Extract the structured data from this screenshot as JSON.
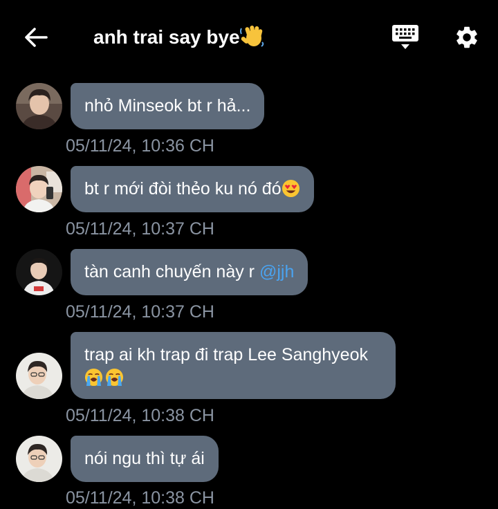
{
  "header": {
    "title": "anh trai say bye",
    "title_emoji": "waving-hand",
    "back_icon": "back-arrow-icon",
    "keyboard_icon": "keyboard-icon",
    "settings_icon": "gear-icon"
  },
  "messages": [
    {
      "text": "nhỏ Minseok bt r hả...",
      "time": "05/11/24, 10:36 CH"
    },
    {
      "text": "bt r mới đòi thẻo ku nó đó",
      "emoji": "heart-eyes-emoji",
      "time": "05/11/24, 10:37 CH"
    },
    {
      "text": "tàn canh chuyến này r ",
      "mention": "@jjh",
      "time": "05/11/24, 10:37 CH"
    },
    {
      "text": "trap ai kh trap đi trap Lee Sanghyeok",
      "emoji": "loudly-crying-emoji",
      "time": "05/11/24, 10:38 CH"
    },
    {
      "text": "nói ngu thì tự ái",
      "time": "05/11/24, 10:38 CH"
    }
  ],
  "colors": {
    "background": "#000000",
    "bubble": "#5e6b7b",
    "timestamp": "#8a94a2",
    "mention": "#4aa3f0"
  }
}
